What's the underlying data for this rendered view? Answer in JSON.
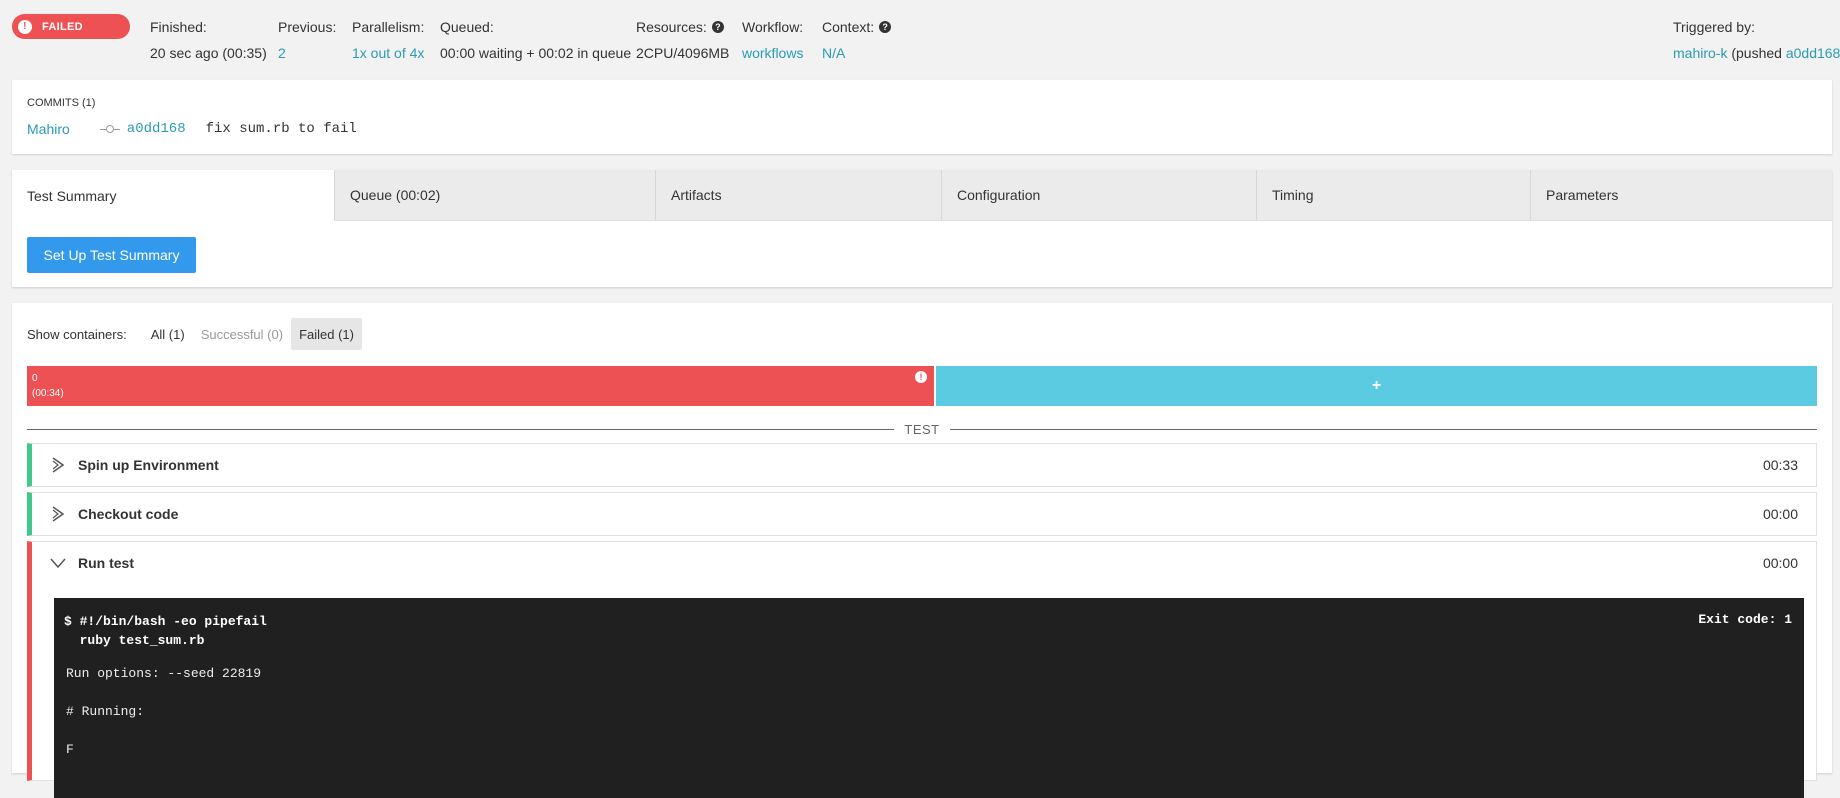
{
  "header": {
    "status": "FAILED",
    "finished": {
      "label": "Finished:",
      "value": "20 sec ago (00:35)"
    },
    "previous": {
      "label": "Previous:",
      "value": "2"
    },
    "parallelism": {
      "label": "Parallelism:",
      "value": "1x out of 4x"
    },
    "queued": {
      "label": "Queued:",
      "value": "00:00 waiting + 00:02 in queue"
    },
    "resources": {
      "label": "Resources:",
      "value": "2CPU/4096MB"
    },
    "workflow": {
      "label": "Workflow:",
      "value": "workflows"
    },
    "context": {
      "label": "Context:",
      "value": "N/A"
    },
    "triggered": {
      "label": "Triggered by:",
      "user": "mahiro-k",
      "pushed_prefix": " (pushed ",
      "commit": "a0dd168",
      "suffix": ")"
    }
  },
  "commits": {
    "title": "COMMITS (1)",
    "items": [
      {
        "author": "Mahiro",
        "hash": "a0dd168",
        "message": "fix sum.rb to fail"
      }
    ]
  },
  "tabs": [
    {
      "label": "Test Summary",
      "active": true
    },
    {
      "label": "Queue (00:02)"
    },
    {
      "label": "Artifacts"
    },
    {
      "label": "Configuration"
    },
    {
      "label": "Timing"
    },
    {
      "label": "Parameters"
    }
  ],
  "setup_button": "Set Up Test Summary",
  "containers": {
    "label": "Show containers:",
    "filters": [
      "All (1)",
      "Successful (0)",
      "Failed (1)"
    ],
    "items": [
      {
        "index": "0",
        "duration": "(00:34)",
        "status": "failed"
      }
    ],
    "add_symbol": "+"
  },
  "section_label": "TEST",
  "steps": [
    {
      "name": "Spin up Environment",
      "duration": "00:33"
    },
    {
      "name": "Checkout code",
      "duration": "00:00"
    },
    {
      "name": "Run test",
      "duration": "00:00"
    }
  ],
  "terminal": {
    "command": "$ #!/bin/bash -eo pipefail\n  ruby test_sum.rb",
    "exit_code": "Exit code: 1",
    "output": "Run options: --seed 22819\n\n# Running:\n\nF"
  },
  "colors": {
    "failed": "#ed5153",
    "success": "#42c88a",
    "link": "#2b9bb3",
    "button": "#3299ec",
    "container_add": "#5bcbe1"
  }
}
